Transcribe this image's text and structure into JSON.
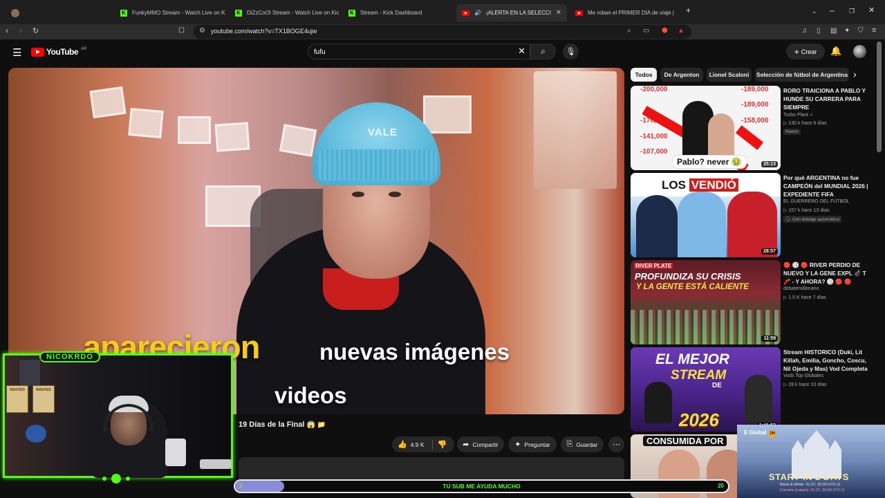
{
  "browser": {
    "tabs": [
      {
        "label": "",
        "favicon": "avatar-icon"
      },
      {
        "label": "FunkyMMO Stream - Watch Live on Kick",
        "favicon": "kick-icon"
      },
      {
        "label": "DiZzCoOl Stream - Watch Live on Kick",
        "favicon": "kick-icon"
      },
      {
        "label": "Stream - Kick Dashboard",
        "favicon": "kick-icon"
      },
      {
        "label": "¡ALERTA EN LA SELECCIÓN! Scaloni...",
        "favicon": "youtube-icon",
        "active": true
      },
      {
        "label": "Me roban el PRIMER DÍA de viaje | Argentina",
        "favicon": "youtube-icon"
      }
    ],
    "url": "youtube.com/watch?v=TX1BOGE4ujw"
  },
  "youtube": {
    "logo_text": "YouTube",
    "country_code": "AR",
    "search_value": "fufu",
    "create_label": "Crear"
  },
  "video": {
    "caption_line1": "aparecieron",
    "caption_line2": "nuevas imágenes",
    "caption_line3": "videos",
    "beanie_text": "VALE",
    "title": "19 Días de la Final",
    "title_emoji": "😱 📁",
    "likes": "4.9 K",
    "share_label": "Compartir",
    "ask_label": "Preguntar",
    "save_label": "Guardar"
  },
  "chips": [
    "Todos",
    "De Argenton",
    "Lionel Scaloni",
    "Selección de fútbol de Argentina"
  ],
  "recommendations": [
    {
      "title": "RORO TRAICIONA A PABLO Y HUNDE SU CARRERA PARA SIEMPRE",
      "channel": "Turbo Plant",
      "verified": true,
      "meta": "130 k   hace 6 días",
      "badge": "Nuevo",
      "duration": "25:13",
      "thumb_text": "Pablo? never 🤢",
      "thumb_numbers": [
        "-200,000",
        "-176,000",
        "-141,000",
        "-107,000",
        "-189,000",
        "-107,000",
        "-189,000",
        "-158,000",
        "-189,000"
      ]
    },
    {
      "title": "Por qué ARGENTINA no fue CAMPEÓN del MUNDIAL 2026 | EXPEDIENTE FIFA",
      "channel": "EL GUERRERO DEL FÚTBOL",
      "meta": "157 k   hace 13 días",
      "badge": "Con doblaje automático",
      "duration": "28:57",
      "thumb_text_a": "LOS",
      "thumb_text_b": "VENDIÓ"
    },
    {
      "title": "🔴 🏐 🔴 RIVER PERDIO DE NUEVO Y LA GENE EXPL 💣 T 🧨 - Y AHORA? 🏐 🔴 🔴",
      "channel": "debatemillonario",
      "meta": "1.5 K   hace 7 días",
      "duration": "11:59",
      "thumb_l1": "RIVER PLATE",
      "thumb_l2": "PROFUNDIZA SU CRISIS",
      "thumb_l3": "Y LA GENTE ESTÁ CALIENTE"
    },
    {
      "title": "Stream HISTORICO (Duki, Lit Killah, Emilia, Goncho, Coscu, Nil Ojeda y Mas) Vod Completa",
      "channel": "Vods Top Globales",
      "meta": "28 k   hace 10 días",
      "duration": "1:41:52",
      "thumb_l1": "EL MEJOR",
      "thumb_l2": "STREAM",
      "thumb_l3": "DE",
      "thumb_l4": "2026"
    },
    {
      "thumb_l1": "CONSUMIDA POR"
    }
  ],
  "overlay": {
    "channel_tag": "NICOKRDO",
    "poster_text": "WANTED",
    "sub_message": "TU SUB ME AYUDA MUCHO",
    "sub_current": "2",
    "sub_goal": "20",
    "sub_progress": 0.1,
    "promo_brand": "E Global",
    "promo_badge": "1H",
    "promo_title": "START IN 2 DAYS",
    "promo_line1": "Black & White: 31.07, 20:00 UTC+3",
    "promo_line2": "Carmine (Latam): 31.07, 20:00 UTC-3"
  },
  "colors": {
    "accent_kick": "#53fc18",
    "youtube_red": "#ff0000",
    "bg": "#0f0f0f"
  }
}
